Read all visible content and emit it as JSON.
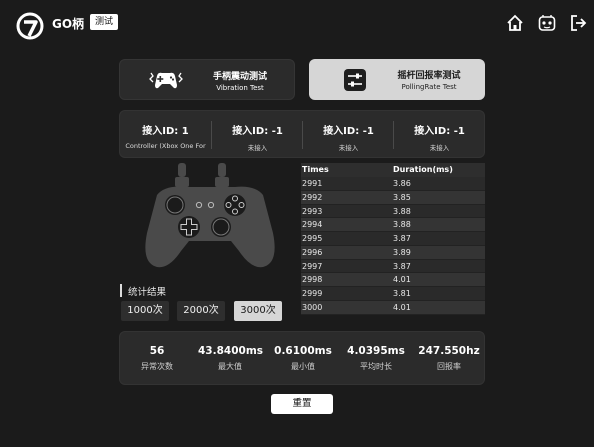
{
  "header": {
    "app_name": "GO柄",
    "badge": "测试",
    "icons": [
      "home-icon",
      "gamepad-icon",
      "logout-icon"
    ]
  },
  "modes": [
    {
      "title": "手柄震动测试",
      "subtitle": "Vibration Test",
      "icon": "vibration-gamepad-icon",
      "active": false
    },
    {
      "title": "摇杆回报率测试",
      "subtitle": "PollingRate Test",
      "icon": "sliders-icon",
      "active": true
    }
  ],
  "connections": [
    {
      "id": "接入ID: 1",
      "device": "Controller (Xbox One For"
    },
    {
      "id": "接入ID: -1",
      "device": "未接入"
    },
    {
      "id": "接入ID: -1",
      "device": "未接入"
    },
    {
      "id": "接入ID: -1",
      "device": "未接入"
    }
  ],
  "stats": {
    "label": "统计结果",
    "buttons": [
      {
        "label": "1000次",
        "selected": false
      },
      {
        "label": "2000次",
        "selected": false
      },
      {
        "label": "3000次",
        "selected": true
      }
    ]
  },
  "table": {
    "headers": [
      "Times",
      "Duration(ms)"
    ],
    "rows": [
      [
        "2991",
        "3.86"
      ],
      [
        "2992",
        "3.85"
      ],
      [
        "2993",
        "3.88"
      ],
      [
        "2994",
        "3.88"
      ],
      [
        "2995",
        "3.87"
      ],
      [
        "2996",
        "3.89"
      ],
      [
        "2997",
        "3.87"
      ],
      [
        "2998",
        "4.01"
      ],
      [
        "2999",
        "3.81"
      ],
      [
        "3000",
        "4.01"
      ]
    ]
  },
  "summary": [
    {
      "value": "56",
      "label": "异常次数"
    },
    {
      "value": "43.8400ms",
      "label": "最大值"
    },
    {
      "value": "0.6100ms",
      "label": "最小值"
    },
    {
      "value": "4.0395ms",
      "label": "平均时长"
    },
    {
      "value": "247.550hz",
      "label": "回报率"
    }
  ],
  "reset_label": "重置",
  "colors": {
    "background": "#1b1b1b",
    "panel": "#2b2b2b",
    "active_card": "#d6d6d6",
    "controller_body": "#4a4a4a"
  }
}
